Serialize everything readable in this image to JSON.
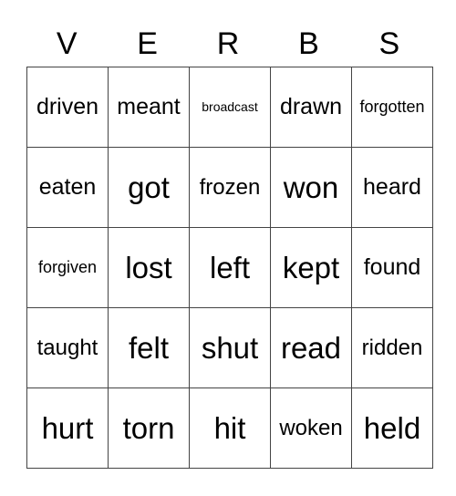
{
  "title_letters": [
    "V",
    "E",
    "R",
    "B",
    "S"
  ],
  "cells": [
    [
      {
        "word": "driven",
        "size": "s24"
      },
      {
        "word": "meant",
        "size": "s24"
      },
      {
        "word": "broadcast",
        "size": "s14"
      },
      {
        "word": "drawn",
        "size": "s24"
      },
      {
        "word": "forgotten",
        "size": "s18"
      }
    ],
    [
      {
        "word": "eaten",
        "size": "s24"
      },
      {
        "word": "got",
        "size": "s32"
      },
      {
        "word": "frozen",
        "size": "s22"
      },
      {
        "word": "won",
        "size": "s32"
      },
      {
        "word": "heard",
        "size": "s24"
      }
    ],
    [
      {
        "word": "forgiven",
        "size": "s18"
      },
      {
        "word": "lost",
        "size": "s32"
      },
      {
        "word": "left",
        "size": "s32"
      },
      {
        "word": "kept",
        "size": "s32"
      },
      {
        "word": "found",
        "size": "s24"
      }
    ],
    [
      {
        "word": "taught",
        "size": "s22"
      },
      {
        "word": "felt",
        "size": "s32"
      },
      {
        "word": "shut",
        "size": "s32"
      },
      {
        "word": "read",
        "size": "s32"
      },
      {
        "word": "ridden",
        "size": "s22"
      }
    ],
    [
      {
        "word": "hurt",
        "size": "s32"
      },
      {
        "word": "torn",
        "size": "s32"
      },
      {
        "word": "hit",
        "size": "s32"
      },
      {
        "word": "woken",
        "size": "s22"
      },
      {
        "word": "held",
        "size": "s32"
      }
    ]
  ]
}
